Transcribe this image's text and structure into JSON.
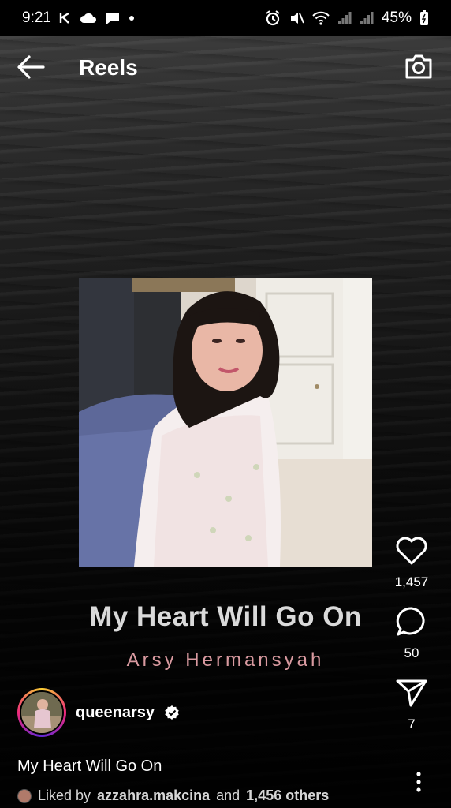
{
  "status_bar": {
    "time": "9:21",
    "left_icons": [
      "k-app-icon",
      "cloud-icon",
      "message-icon",
      "dot-icon"
    ],
    "right_icons": [
      "alarm-icon",
      "mute-icon",
      "wifi-icon",
      "signal-icon",
      "signal-icon",
      "battery-icon"
    ],
    "battery": "45%"
  },
  "header": {
    "title": "Reels",
    "back_icon": "arrow-left-icon",
    "camera_icon": "camera-icon"
  },
  "reel": {
    "song_title": "My Heart Will Go On",
    "artist": "Arsy Hermansyah",
    "colors": {
      "artist": "#d99aa0"
    }
  },
  "actions": {
    "likes": "1,457",
    "comments": "50",
    "shares": "7"
  },
  "author": {
    "username": "queenarsy",
    "verified": true
  },
  "caption": "My Heart Will Go On",
  "liked_by": {
    "prefix": "Liked by",
    "user": "azzahra.makcina",
    "middle": "and",
    "others": "1,456 others"
  }
}
